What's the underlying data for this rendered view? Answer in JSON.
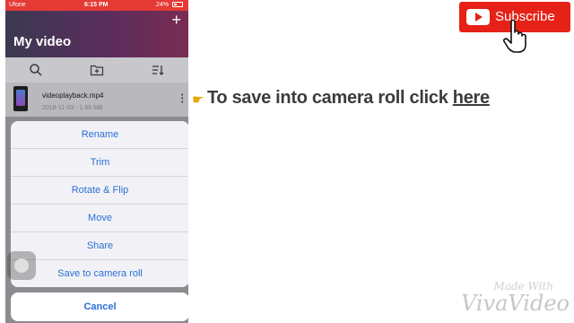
{
  "status_bar": {
    "carrier": "Ufone",
    "time": "6:15 PM",
    "battery": "24%"
  },
  "app": {
    "title": "My video",
    "add_button": "+"
  },
  "toolbar": {
    "icons": [
      "search-icon",
      "new-folder-icon",
      "sort-icon"
    ]
  },
  "file": {
    "name": "videoplayback.mp4",
    "meta": "2018-11-03 - 1.66 MB"
  },
  "action_sheet": {
    "items": [
      {
        "label": "Rename"
      },
      {
        "label": "Trim"
      },
      {
        "label": "Rotate & Flip"
      },
      {
        "label": "Move"
      },
      {
        "label": "Share"
      },
      {
        "label": "Save to camera roll"
      }
    ],
    "cancel": "Cancel"
  },
  "annotation": {
    "text": "To save into camera roll click ",
    "link": "here"
  },
  "subscribe": {
    "label": "Subscribe"
  },
  "watermark": {
    "line1": "Made With",
    "line2": "VivaVideo"
  },
  "colors": {
    "status_bar": "#e53a35",
    "accent": "#2a6fd6",
    "subscribe": "#e62117",
    "header_gradient": [
      "#3a3a52",
      "#7a2c52"
    ]
  }
}
